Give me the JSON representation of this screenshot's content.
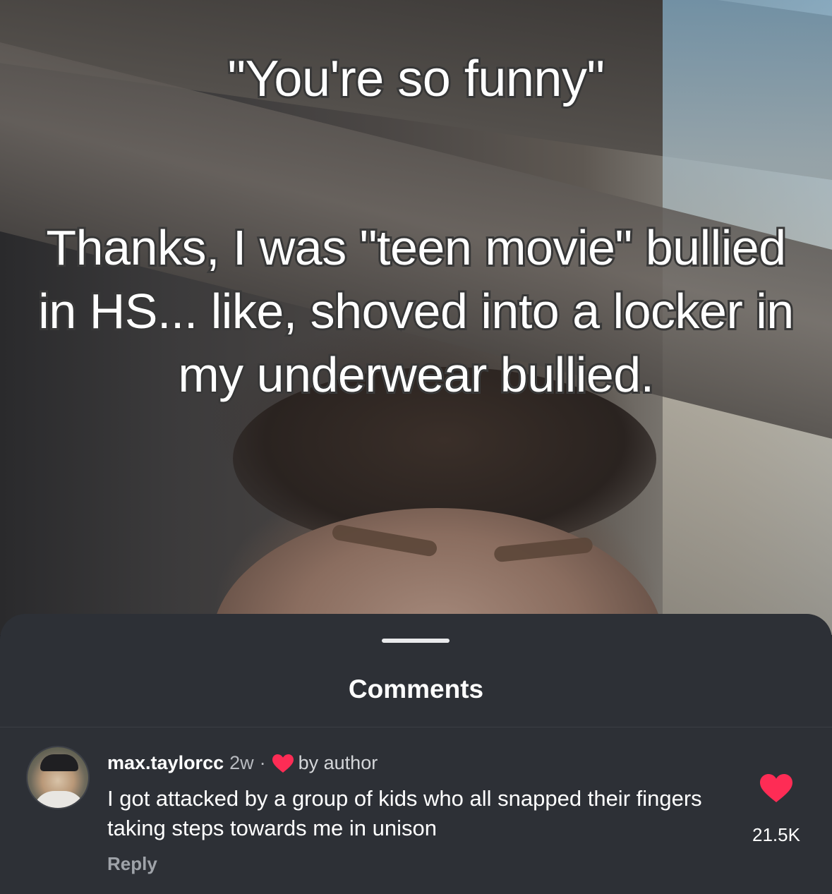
{
  "video": {
    "caption_line1": "\"You're so funny\"",
    "caption_line2": "Thanks, I was \"teen movie\" bullied in HS... like, shoved into a locker in my underwear bullied."
  },
  "comments_sheet": {
    "title": "Comments",
    "comment": {
      "username": "max.taylorcc",
      "time": "2w",
      "separator": "·",
      "author_badge": "by author",
      "text": "I got attacked by a group of kids who all snapped their fingers taking steps towards me in unison",
      "reply_label": "Reply",
      "like_count": "21.5K"
    }
  },
  "colors": {
    "sheet_bg": "#2d3036",
    "heart_red": "#fe2c55",
    "text_primary": "#ffffff",
    "text_secondary": "#9fa3a9"
  },
  "icons": {
    "author_heart": "heart-icon",
    "like": "heart-icon"
  }
}
